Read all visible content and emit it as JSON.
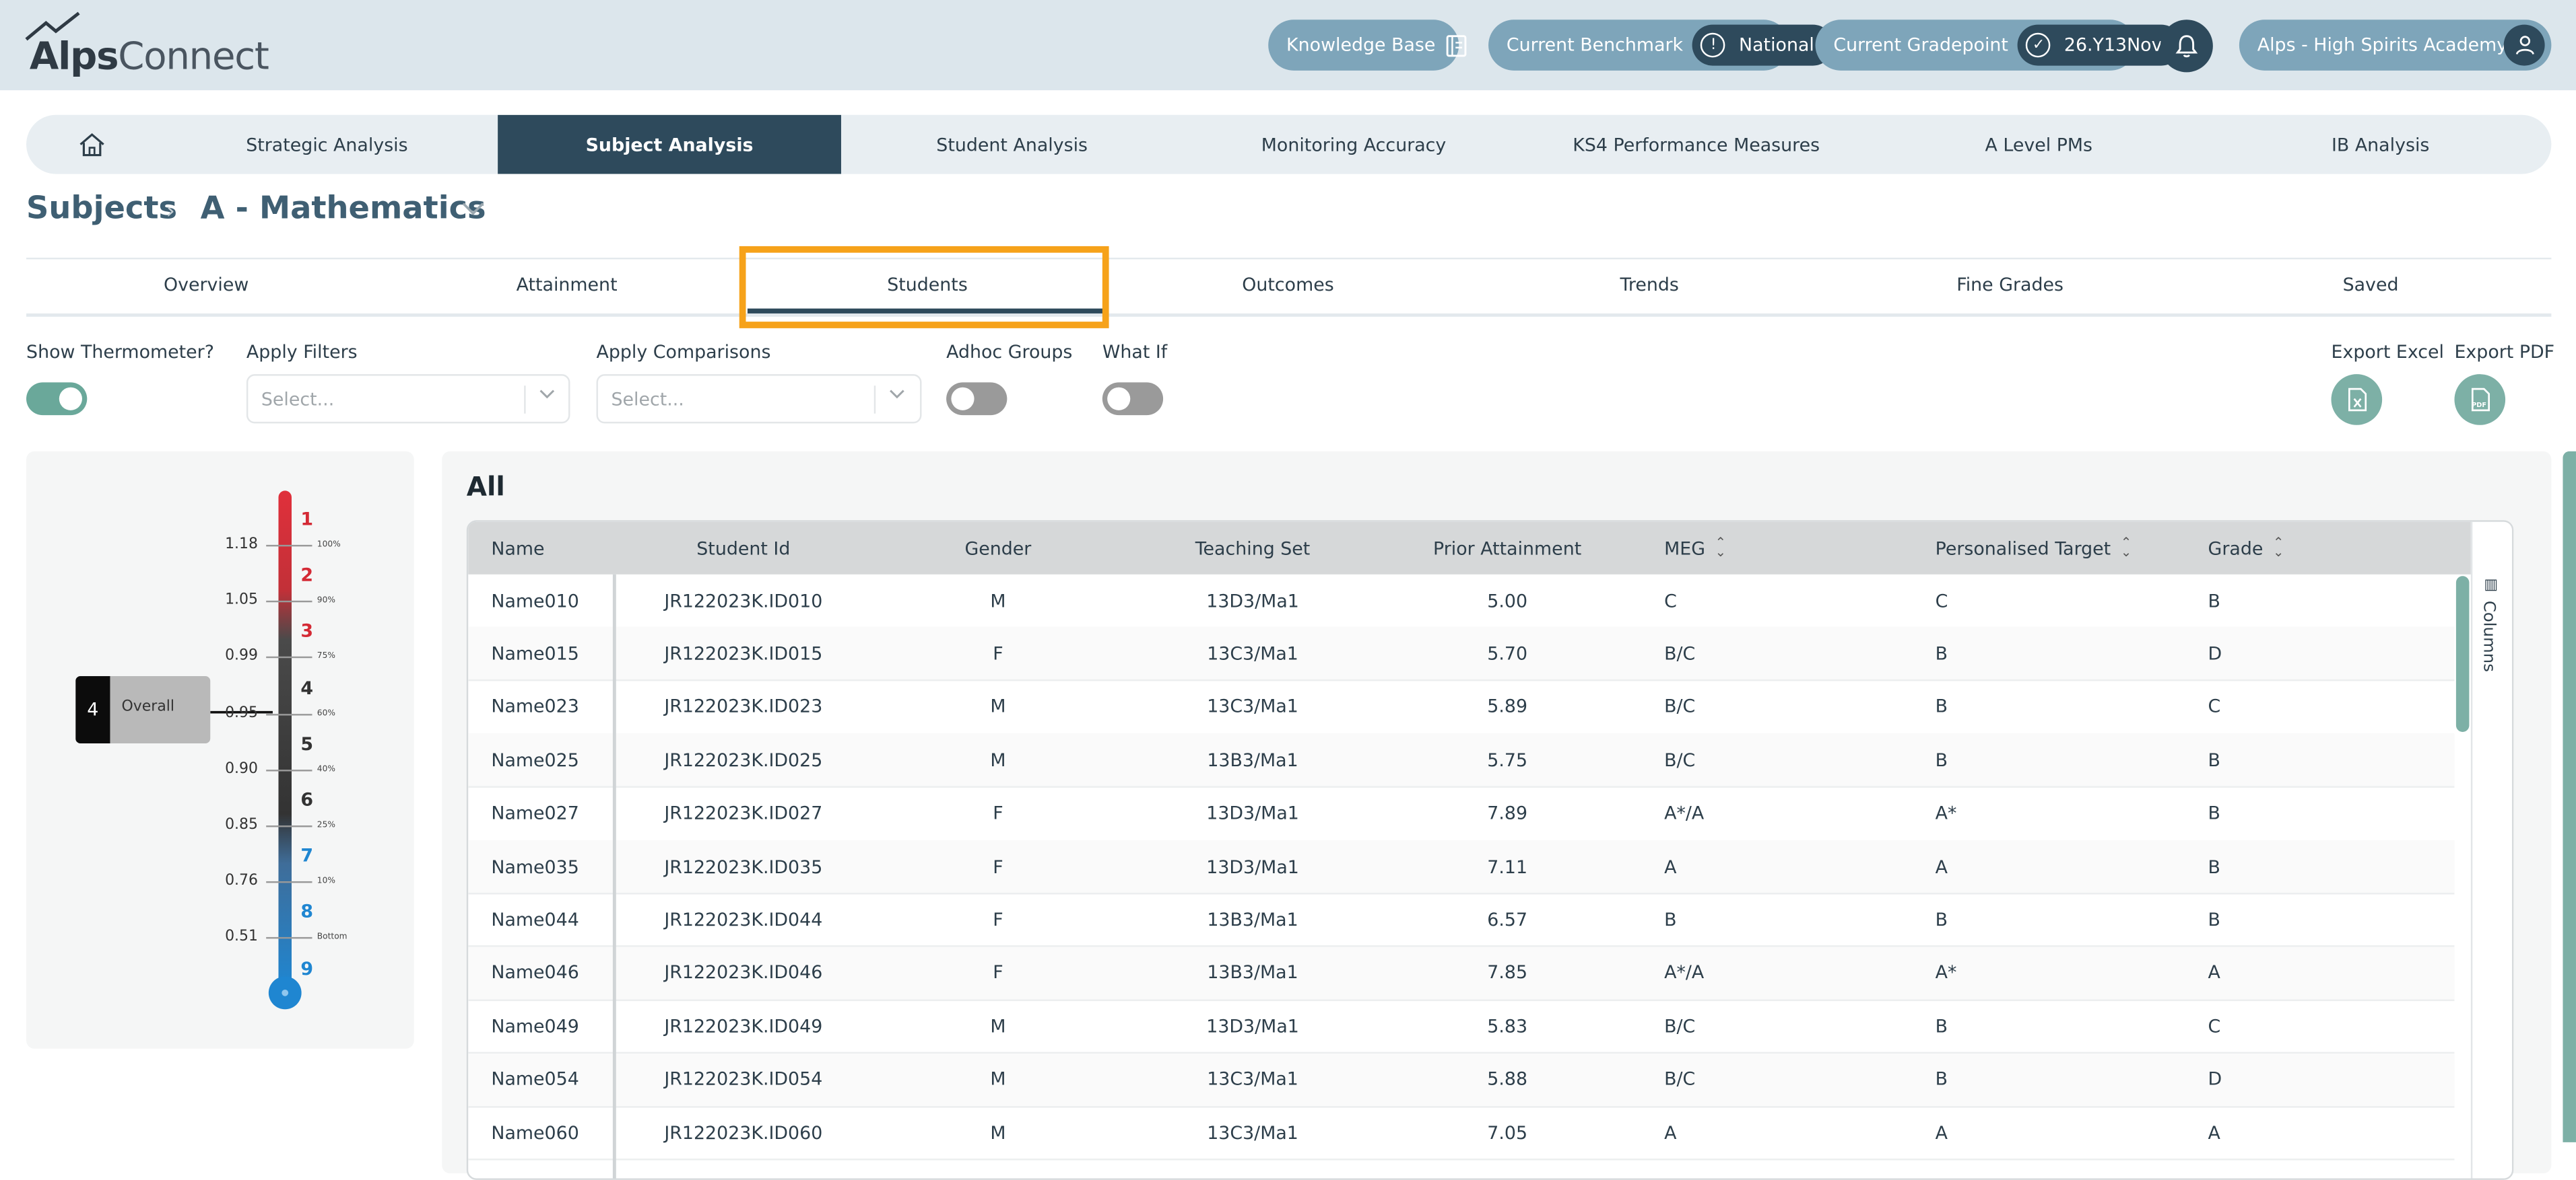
{
  "app": {
    "logo_text_bold": "Alps",
    "logo_text_regular": "Connect"
  },
  "header": {
    "knowledge_base": "Knowledge Base",
    "benchmark_label": "Current Benchmark",
    "benchmark_value": "National",
    "gradepoint_label": "Current Gradepoint",
    "gradepoint_value": "26.Y13Nov",
    "account": "Alps - High Spirits Academy (E)"
  },
  "main_nav": {
    "items": [
      "Strategic Analysis",
      "Subject Analysis",
      "Student Analysis",
      "Monitoring Accuracy",
      "KS4 Performance Measures",
      "A Level PMs",
      "IB Analysis"
    ],
    "active": "Subject Analysis"
  },
  "breadcrumb": {
    "root": "Subjects",
    "current": "A - Mathematics"
  },
  "sub_tabs": {
    "items": [
      "Overview",
      "Attainment",
      "Students",
      "Outcomes",
      "Trends",
      "Fine Grades",
      "Saved"
    ],
    "active": "Students"
  },
  "controls": {
    "show_thermometer_label": "Show Thermometer?",
    "show_thermometer_on": true,
    "apply_filters_label": "Apply Filters",
    "apply_filters_placeholder": "Select...",
    "apply_comparisons_label": "Apply Comparisons",
    "apply_comparisons_placeholder": "Select...",
    "adhoc_groups_label": "Adhoc Groups",
    "adhoc_groups_on": false,
    "what_if_label": "What If",
    "what_if_on": false,
    "export_excel_label": "Export Excel",
    "export_pdf_label": "Export PDF",
    "pdf_icon_text": "PDF"
  },
  "thermometer": {
    "grades": [
      "1",
      "2",
      "3",
      "4",
      "5",
      "6",
      "7",
      "8",
      "9"
    ],
    "values": [
      "1.18",
      "1.05",
      "0.99",
      "0.95",
      "0.90",
      "0.85",
      "0.76",
      "0.51"
    ],
    "percentiles": [
      "100%",
      "90%",
      "75%",
      "60%",
      "40%",
      "25%",
      "10%",
      "Bottom"
    ],
    "overall_label": "Overall",
    "overall_grade": "4",
    "colors": {
      "top": "#e0303b",
      "middle": "#3a3a3a",
      "bottom": "#1f86d1"
    }
  },
  "table": {
    "title": "All",
    "columns": [
      "Name",
      "Student Id",
      "Gender",
      "Teaching Set",
      "Prior Attainment",
      "MEG",
      "Personalised Target",
      "Grade"
    ],
    "columns_side_label": "Columns",
    "rows": [
      [
        "Name010",
        "JR122023K.ID010",
        "M",
        "13D3/Ma1",
        "5.00",
        "C",
        "C",
        "B"
      ],
      [
        "Name015",
        "JR122023K.ID015",
        "F",
        "13C3/Ma1",
        "5.70",
        "B/C",
        "B",
        "D"
      ],
      [
        "Name023",
        "JR122023K.ID023",
        "M",
        "13C3/Ma1",
        "5.89",
        "B/C",
        "B",
        "C"
      ],
      [
        "Name025",
        "JR122023K.ID025",
        "M",
        "13B3/Ma1",
        "5.75",
        "B/C",
        "B",
        "B"
      ],
      [
        "Name027",
        "JR122023K.ID027",
        "F",
        "13D3/Ma1",
        "7.89",
        "A*/A",
        "A*",
        "B"
      ],
      [
        "Name035",
        "JR122023K.ID035",
        "F",
        "13D3/Ma1",
        "7.11",
        "A",
        "A",
        "B"
      ],
      [
        "Name044",
        "JR122023K.ID044",
        "F",
        "13B3/Ma1",
        "6.57",
        "B",
        "B",
        "B"
      ],
      [
        "Name046",
        "JR122023K.ID046",
        "F",
        "13B3/Ma1",
        "7.85",
        "A*/A",
        "A*",
        "A"
      ],
      [
        "Name049",
        "JR122023K.ID049",
        "M",
        "13D3/Ma1",
        "5.83",
        "B/C",
        "B",
        "C"
      ],
      [
        "Name054",
        "JR122023K.ID054",
        "M",
        "13C3/Ma1",
        "5.88",
        "B/C",
        "B",
        "D"
      ],
      [
        "Name060",
        "JR122023K.ID060",
        "M",
        "13C3/Ma1",
        "7.05",
        "A",
        "A",
        "A"
      ]
    ]
  },
  "theme": {
    "primary": "#2e4a5c",
    "accent": "#7db0a6",
    "pill": "#7ea5ba",
    "highlight": "#f6a21a"
  }
}
